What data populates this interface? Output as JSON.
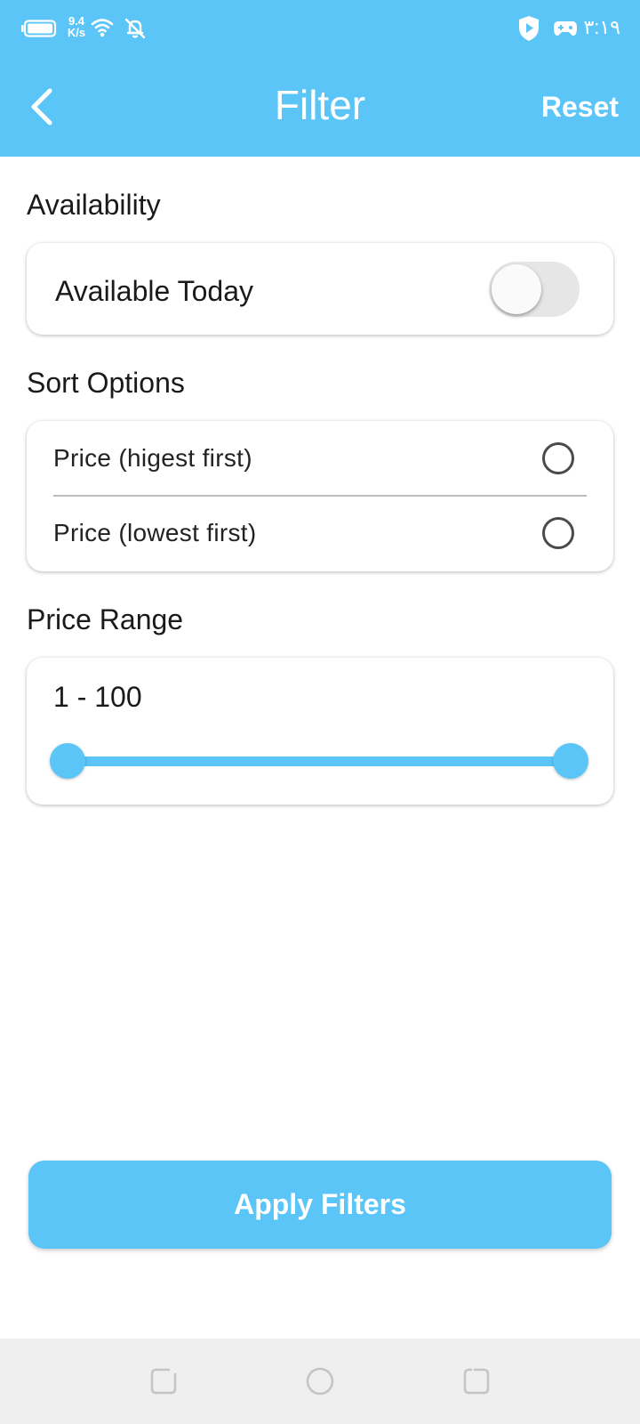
{
  "status_bar": {
    "net_speed_value": "9.4",
    "net_speed_unit": "K/s",
    "time": "۳:۱۹",
    "icons": [
      "battery-icon",
      "wifi-icon",
      "bell-off-icon",
      "shield-icon",
      "gamepad-icon"
    ]
  },
  "app_bar": {
    "title": "Filter",
    "reset_label": "Reset",
    "back_icon": "chevron-left-icon"
  },
  "availability": {
    "section_title": "Availability",
    "option_label": "Available Today",
    "toggle_on": false
  },
  "sort": {
    "section_title": "Sort Options",
    "options": [
      {
        "label": "Price (higest first)",
        "selected": false
      },
      {
        "label": "Price (lowest first)",
        "selected": false
      }
    ]
  },
  "price_range": {
    "section_title": "Price Range",
    "range_label": "1 - 100",
    "min": 1,
    "max": 100,
    "selected_min": 1,
    "selected_max": 100
  },
  "apply_label": "Apply Filters",
  "nav_bar": {
    "icons": [
      "recent-apps-icon",
      "home-icon",
      "back-icon"
    ]
  },
  "colors": {
    "accent": "#5bc5f7",
    "radio_border": "#4a4a4f",
    "nav_background": "#efefef"
  }
}
